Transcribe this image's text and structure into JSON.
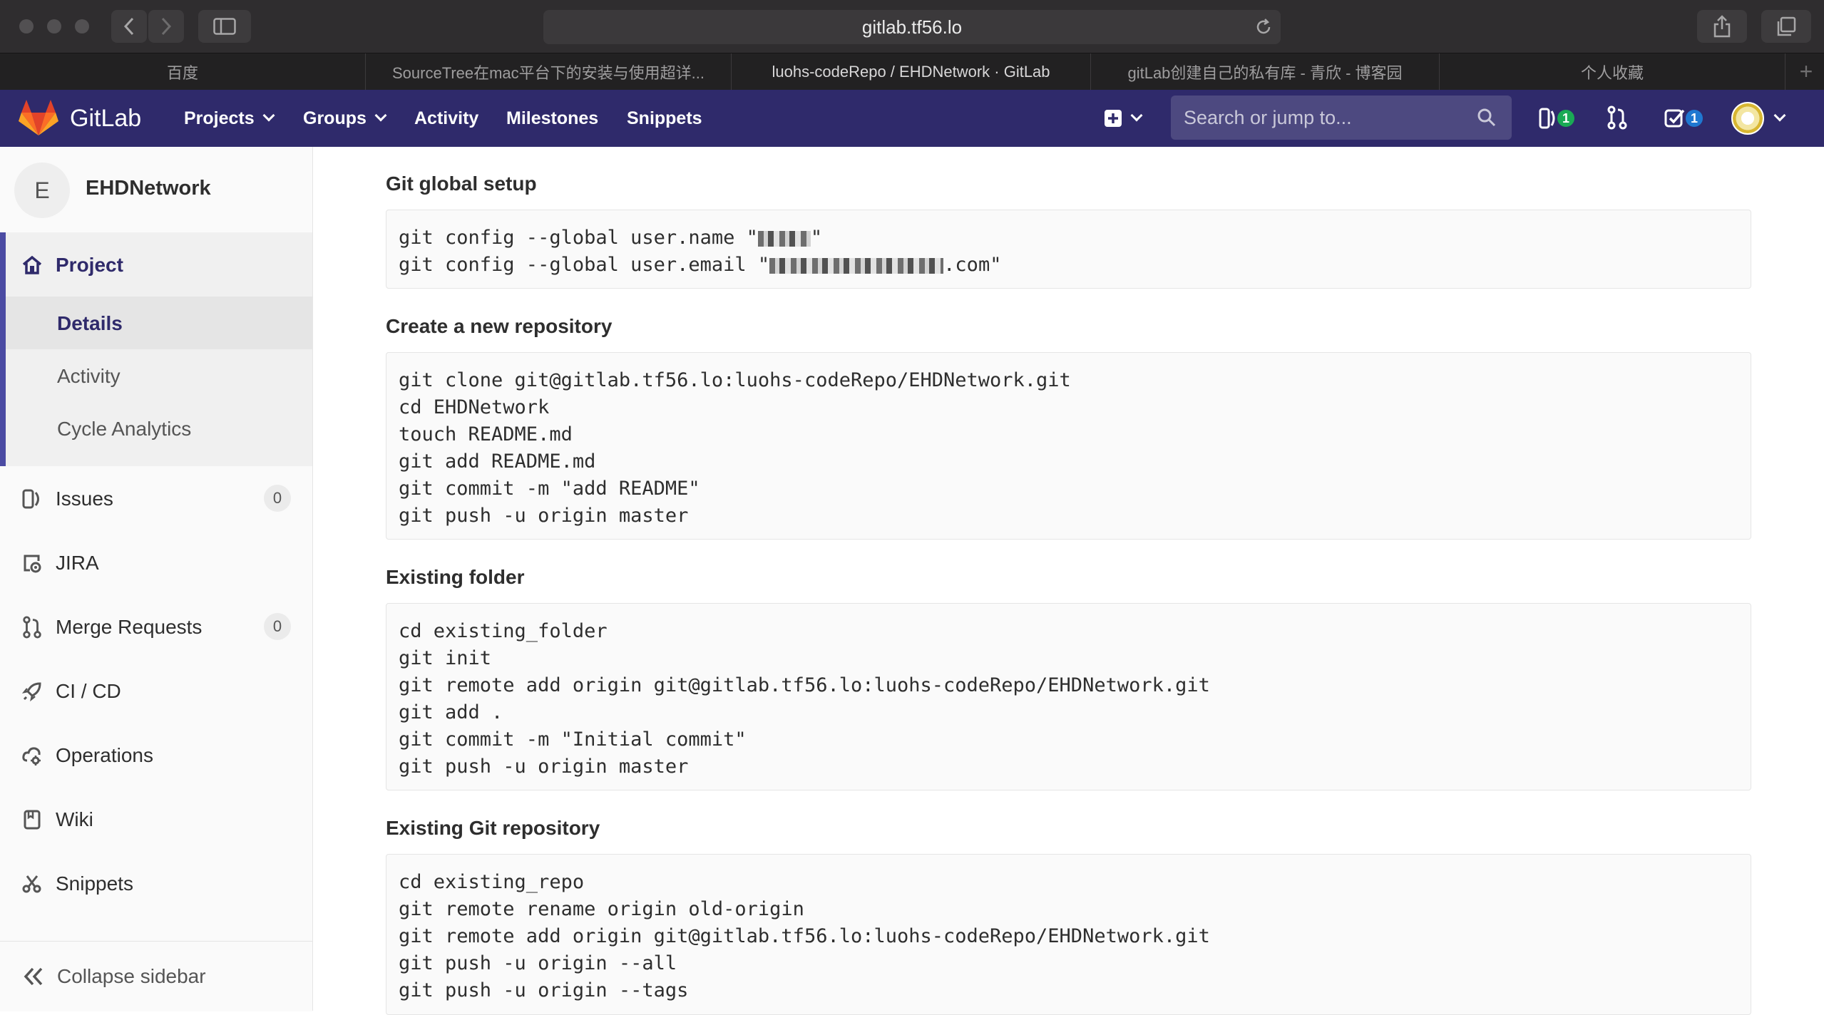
{
  "browser": {
    "url": "gitlab.tf56.lo",
    "tabs": [
      "百度",
      "SourceTree在mac平台下的安装与使用超详...",
      "luohs-codeRepo / EHDNetwork · GitLab",
      "gitLab创建自己的私有库 - 青欣 - 博客园",
      "个人收藏"
    ]
  },
  "navbar": {
    "brand": "GitLab",
    "links": [
      "Projects",
      "Groups",
      "Activity",
      "Milestones",
      "Snippets"
    ],
    "search_placeholder": "Search or jump to...",
    "issues_badge": "1",
    "todos_badge": "1",
    "colors": {
      "navbar_bg": "#2f2a6b",
      "issues_badge": "#1aaa55",
      "todos_badge": "#1f78d1"
    }
  },
  "sidebar": {
    "avatar_letter": "E",
    "project_name": "EHDNetwork",
    "project_label": "Project",
    "project_sub": [
      "Details",
      "Activity",
      "Cycle Analytics"
    ],
    "items": [
      {
        "label": "Issues",
        "count": "0",
        "icon": "issues-icon"
      },
      {
        "label": "JIRA",
        "icon": "jira-icon"
      },
      {
        "label": "Merge Requests",
        "count": "0",
        "icon": "merge-request-icon"
      },
      {
        "label": "CI / CD",
        "icon": "rocket-icon"
      },
      {
        "label": "Operations",
        "icon": "cloud-gear-icon"
      },
      {
        "label": "Wiki",
        "icon": "book-icon"
      },
      {
        "label": "Snippets",
        "icon": "scissors-icon"
      }
    ],
    "collapse_label": "Collapse sidebar"
  },
  "content": {
    "global_setup": {
      "title": "Git global setup",
      "line1_prefix": "git config --global user.name \"",
      "line1_suffix": "\"",
      "line2_prefix": "git config --global user.email \"",
      "line2_suffix": ".com\""
    },
    "new_repo": {
      "title": "Create a new repository",
      "code": "git clone git@gitlab.tf56.lo:luohs-codeRepo/EHDNetwork.git\ncd EHDNetwork\ntouch README.md\ngit add README.md\ngit commit -m \"add README\"\ngit push -u origin master"
    },
    "existing_folder": {
      "title": "Existing folder",
      "code": "cd existing_folder\ngit init\ngit remote add origin git@gitlab.tf56.lo:luohs-codeRepo/EHDNetwork.git\ngit add .\ngit commit -m \"Initial commit\"\ngit push -u origin master"
    },
    "existing_repo": {
      "title": "Existing Git repository",
      "code": "cd existing_repo\ngit remote rename origin old-origin\ngit remote add origin git@gitlab.tf56.lo:luohs-codeRepo/EHDNetwork.git\ngit push -u origin --all\ngit push -u origin --tags"
    }
  }
}
